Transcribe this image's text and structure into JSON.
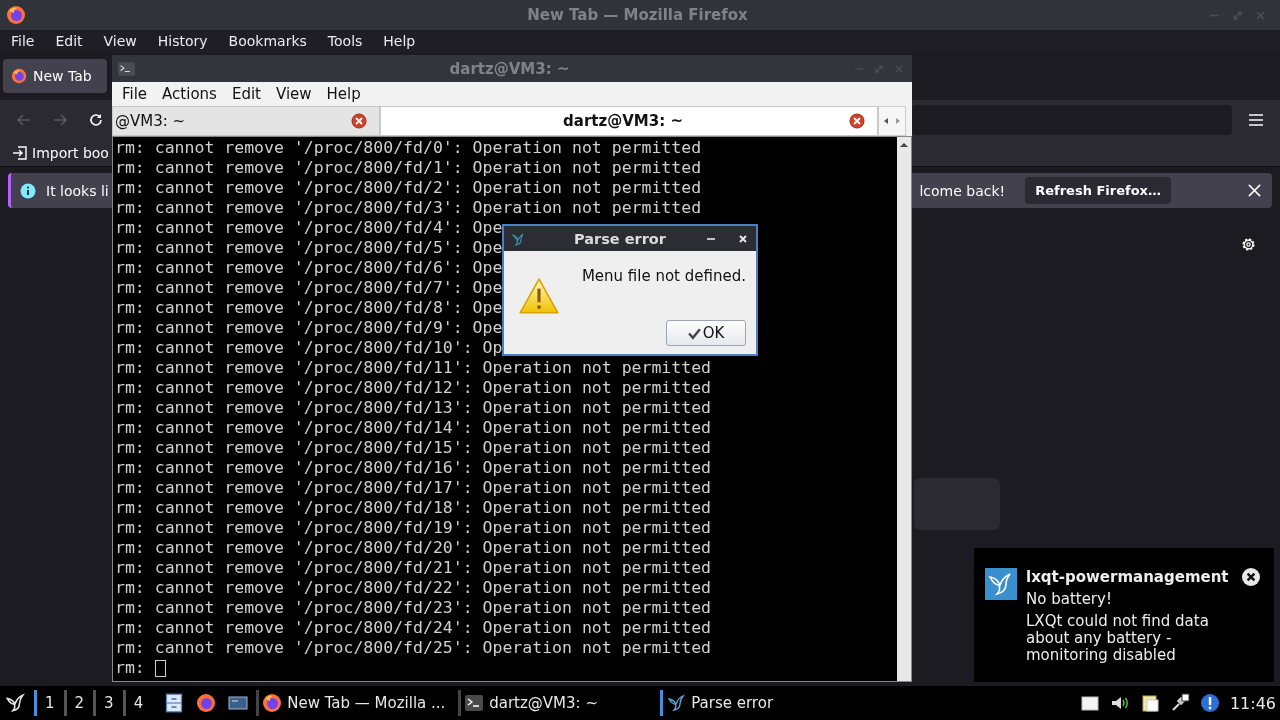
{
  "firefox": {
    "title": "New Tab — Mozilla Firefox",
    "menu": [
      "File",
      "Edit",
      "View",
      "History",
      "Bookmarks",
      "Tools",
      "Help"
    ],
    "tabs": [
      {
        "label": "New Tab",
        "selected": true
      }
    ],
    "bookmark_item": "Import boo",
    "infobar": {
      "message_start": "It looks li",
      "message_end": "lcome back!",
      "button": "Refresh Firefox…"
    }
  },
  "terminal": {
    "title": "dartz@VM3: ~",
    "menu": [
      "File",
      "Actions",
      "Edit",
      "View",
      "Help"
    ],
    "tabs": [
      {
        "label": "@VM3: ~",
        "selected": false
      },
      {
        "label": "dartz@VM3: ~",
        "selected": true
      }
    ],
    "lines": [
      "rm: cannot remove '/proc/800/fd/0': Operation not permitted",
      "rm: cannot remove '/proc/800/fd/1': Operation not permitted",
      "rm: cannot remove '/proc/800/fd/2': Operation not permitted",
      "rm: cannot remove '/proc/800/fd/3': Operation not permitted",
      "rm: cannot remove '/proc/800/fd/4': Ope",
      "rm: cannot remove '/proc/800/fd/5': Ope",
      "rm: cannot remove '/proc/800/fd/6': Ope",
      "rm: cannot remove '/proc/800/fd/7': Ope",
      "rm: cannot remove '/proc/800/fd/8': Ope",
      "rm: cannot remove '/proc/800/fd/9': Ope",
      "rm: cannot remove '/proc/800/fd/10': Op",
      "rm: cannot remove '/proc/800/fd/11': Operation not permitted",
      "rm: cannot remove '/proc/800/fd/12': Operation not permitted",
      "rm: cannot remove '/proc/800/fd/13': Operation not permitted",
      "rm: cannot remove '/proc/800/fd/14': Operation not permitted",
      "rm: cannot remove '/proc/800/fd/15': Operation not permitted",
      "rm: cannot remove '/proc/800/fd/16': Operation not permitted",
      "rm: cannot remove '/proc/800/fd/17': Operation not permitted",
      "rm: cannot remove '/proc/800/fd/18': Operation not permitted",
      "rm: cannot remove '/proc/800/fd/19': Operation not permitted",
      "rm: cannot remove '/proc/800/fd/20': Operation not permitted",
      "rm: cannot remove '/proc/800/fd/21': Operation not permitted",
      "rm: cannot remove '/proc/800/fd/22': Operation not permitted",
      "rm: cannot remove '/proc/800/fd/23': Operation not permitted",
      "rm: cannot remove '/proc/800/fd/24': Operation not permitted",
      "rm: cannot remove '/proc/800/fd/25': Operation not permitted"
    ],
    "prompt": "rm:"
  },
  "dialog": {
    "title": "Parse error",
    "message": "Menu file not defined.",
    "button": "OK"
  },
  "notification": {
    "app": "lxqt-powermanagement",
    "summary": "No battery!",
    "body": "LXQt could not find data about any battery - monitoring disabled"
  },
  "taskbar": {
    "desktops": [
      {
        "label": "1",
        "selected": true
      },
      {
        "label": "2",
        "selected": false
      },
      {
        "label": "3",
        "selected": false
      },
      {
        "label": "4",
        "selected": false
      }
    ],
    "tasks": [
      {
        "label": "New Tab — Mozilla ...",
        "kind": "browser",
        "selected": false
      },
      {
        "label": "dartz@VM3: ~",
        "kind": "terminal",
        "selected": false
      },
      {
        "label": "Parse error",
        "kind": "dialog",
        "selected": true
      }
    ],
    "clock": "11:46"
  }
}
